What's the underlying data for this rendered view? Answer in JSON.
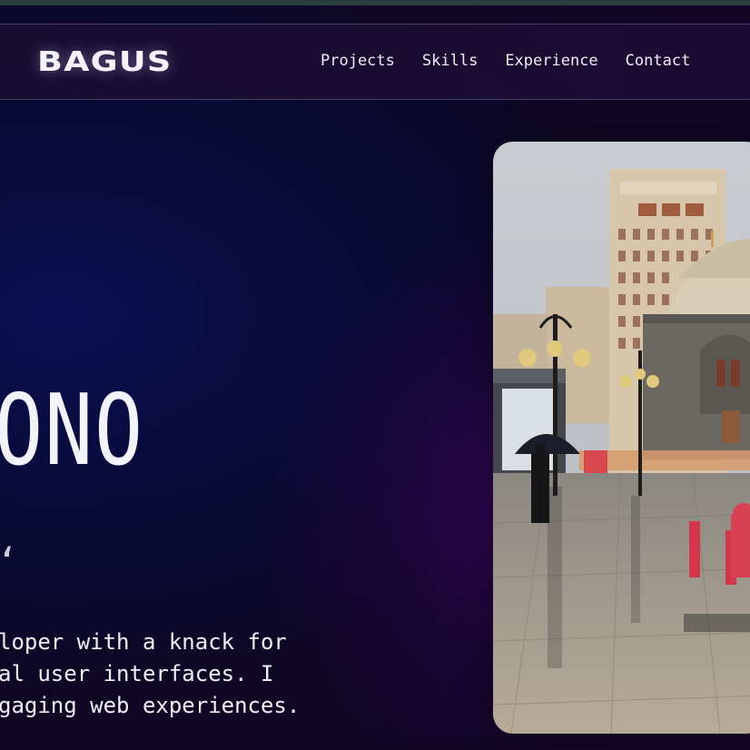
{
  "nav": {
    "logo": "BAGUS",
    "links": [
      "Projects",
      "Skills",
      "Experience",
      "Contact"
    ]
  },
  "hero": {
    "title_fragment": "ONO",
    "subtitle_fragment": "ʻ",
    "description_lines": [
      "loper with a knack for",
      "al user interfaces. I",
      "gaging web experiences."
    ]
  },
  "photo": {
    "icon": "street-photo-image"
  }
}
